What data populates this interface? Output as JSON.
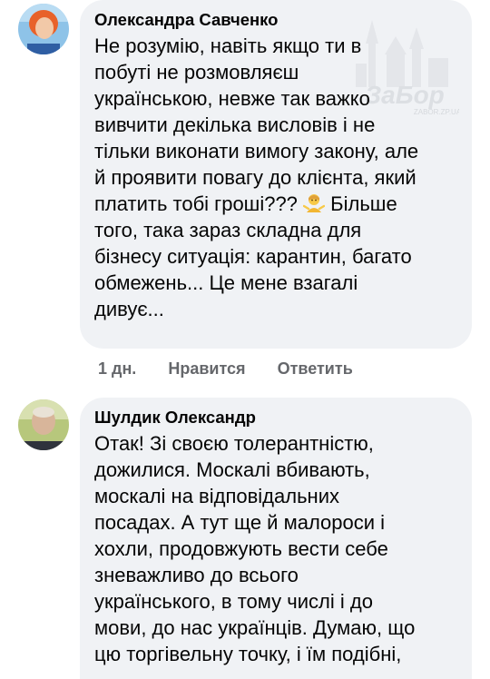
{
  "comments": [
    {
      "author": "Олександра Савченко",
      "lines": [
        "Не розумію, навіть якщо ти в",
        "побуті не розмовляєш",
        "українською, невже так важко",
        "вивчити декілька висловів і не",
        "тільки виконати вимогу закону, але",
        "й проявити повагу до клієнта, який",
        "платить тобі гроші???",
        "того, така зараз складна для",
        "бізнесу ситуація: карантин, багато",
        "обмежень... Це мене взагалі",
        "дивує..."
      ],
      "line7_tail": "Більше",
      "emoji": "shrug-emoji",
      "time": "1 дн.",
      "like_label": "Нравится",
      "reply_label": "Ответить"
    },
    {
      "author": "Шулдик Олександр",
      "lines": [
        "Отак!  Зі своєю толерантністю,",
        "дожилися. Москалі вбивають,",
        "москалі на відповідальних",
        "посадах. А тут ще й малороси і",
        "хохли,  продовжують  вести себе",
        "зневажливо до всього",
        "українського, в тому числі і до",
        "мови, до нас українців. Думаю,  що",
        "цю торгівельну точку, і їм подібні,"
      ]
    }
  ],
  "watermark": {
    "brand": "ЗаБор",
    "site": "ZABOR.ZP.UA"
  },
  "colors": {
    "bubble": "#f0f2f5",
    "text": "#050505",
    "meta": "#65676b"
  }
}
